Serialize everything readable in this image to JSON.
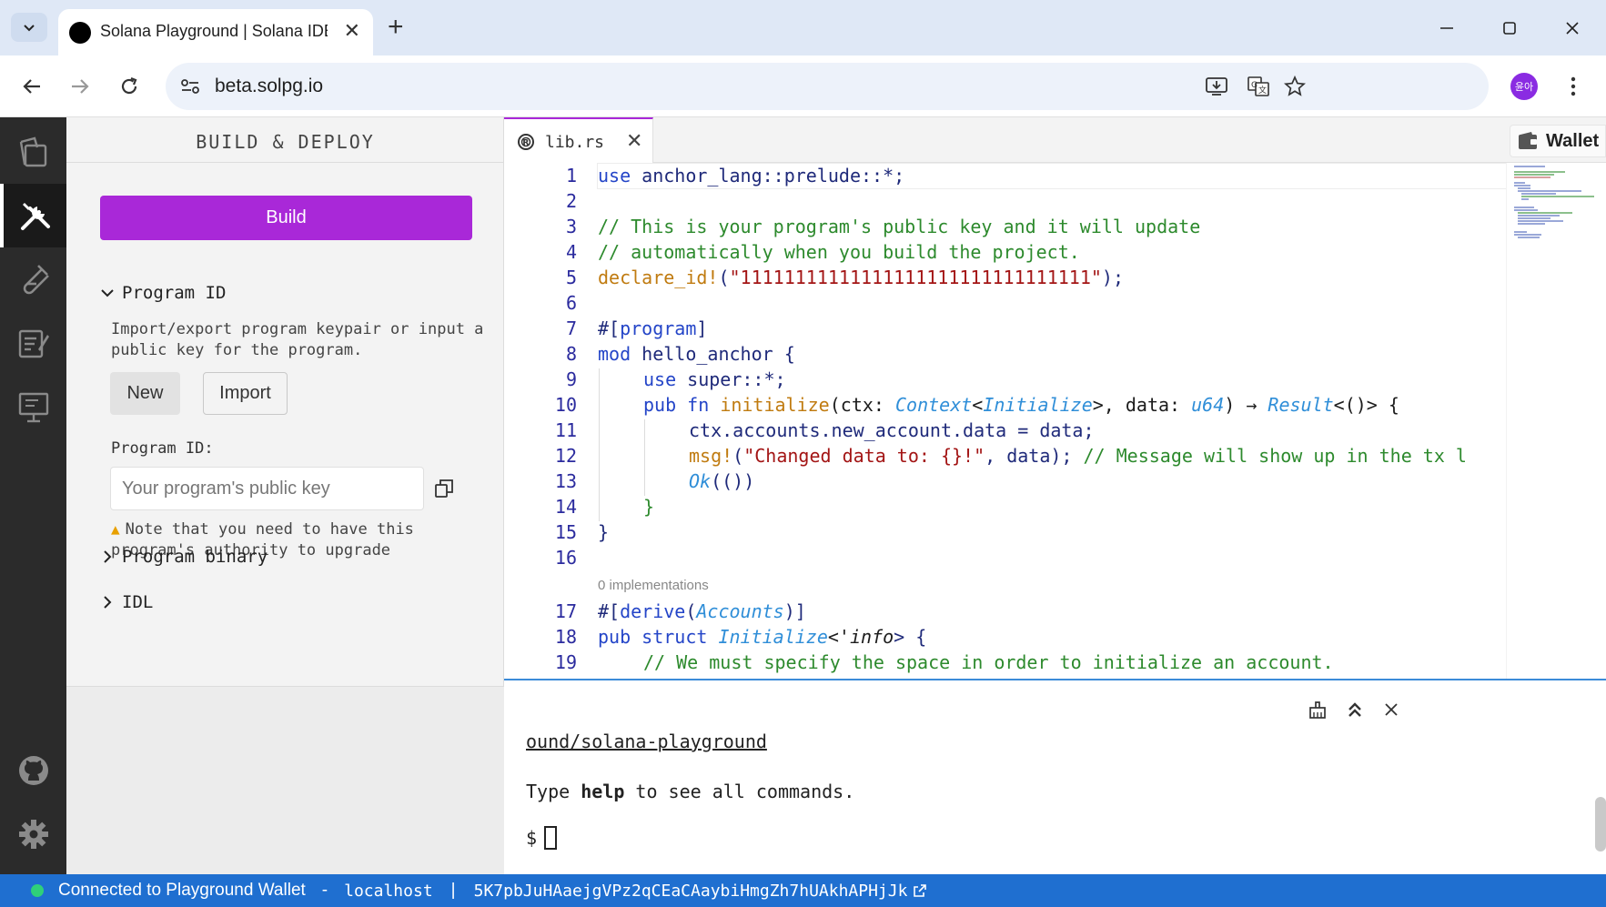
{
  "browser": {
    "tab_title": "Solana Playground | Solana IDE",
    "url": "beta.solpg.io",
    "profile_initials": "윤아"
  },
  "sidebar": {
    "title": "BUILD & DEPLOY",
    "build_label": "Build",
    "program_id_section": {
      "heading": "Program ID",
      "description": "Import/export program keypair or input a public key for the program.",
      "new_label": "New",
      "import_label": "Import",
      "field_label": "Program ID:",
      "field_placeholder": "Your program's public key",
      "field_value": "",
      "warning": "Note that you need to have this program's authority to upgrade"
    },
    "program_binary_heading": "Program binary",
    "idl_heading": "IDL"
  },
  "editor": {
    "file_name": "lib.rs",
    "wallet_label": "Wallet",
    "line_numbers": [
      "1",
      "2",
      "3",
      "4",
      "5",
      "6",
      "7",
      "8",
      "9",
      "10",
      "11",
      "12",
      "13",
      "14",
      "15",
      "16",
      "17",
      "18",
      "19"
    ],
    "codelens": "0 implementations",
    "lines": {
      "l1": {
        "kw": "use",
        "rest": " anchor_lang::prelude::*;"
      },
      "l3": "// This is your program's public key and it will update",
      "l4": "// automatically when you build the project.",
      "l5": {
        "macro": "declare_id!",
        "open": "(",
        "str": "\"11111111111111111111111111111111\"",
        "close": ");"
      },
      "l7": {
        "hash": "#[",
        "attr": "program",
        "close": "]"
      },
      "l8": {
        "kw": "mod",
        "name": " hello_anchor {"
      },
      "l9": {
        "kw": "use",
        "rest": " super::*;"
      },
      "l10": {
        "kw1": "pub",
        "kw2": "fn",
        "fn": "initialize",
        "p1": "(ctx: ",
        "t1": "Context",
        "p2": "<",
        "t2": "Initialize",
        "p3": ">, data: ",
        "t3": "u64",
        "p4": ") → ",
        "t4": "Result",
        "p5": "<()> {"
      },
      "l11": "ctx.accounts.new_account.data = data;",
      "l12": {
        "macro": "msg!",
        "p1": "(",
        "str": "\"Changed data to: {}!\"",
        "p2": ", data); ",
        "comment": "// Message will show up in the tx l"
      },
      "l13": {
        "t": "Ok",
        "p": "(())"
      },
      "l14": "}",
      "l15": "}",
      "l17": {
        "hash": "#[",
        "attr": "derive",
        "p1": "(",
        "t": "Accounts",
        "p2": ")]"
      },
      "l18": {
        "kw1": "pub",
        "kw2": "struct",
        "t": "Initialize",
        "p1": "<'",
        "life": "info",
        "p2": "> {"
      },
      "l19": "// We must specify the space in order to initialize an account."
    }
  },
  "terminal": {
    "link_line": "ound/solana-playground",
    "help_prefix": "Type ",
    "help_word": "help",
    "help_suffix": " to see all commands.",
    "prompt": "$"
  },
  "statusbar": {
    "connection": "Connected to Playground Wallet",
    "separator1": "-",
    "network": "localhost",
    "separator2": "|",
    "address": "5K7pbJuHAaejgVPz2qCEaCAaybiHmgZh7hUAkhAPHjJk"
  },
  "colors": {
    "accent": "#a928d8",
    "statusbar": "#1f6fd0",
    "connected": "#2fd07a"
  }
}
